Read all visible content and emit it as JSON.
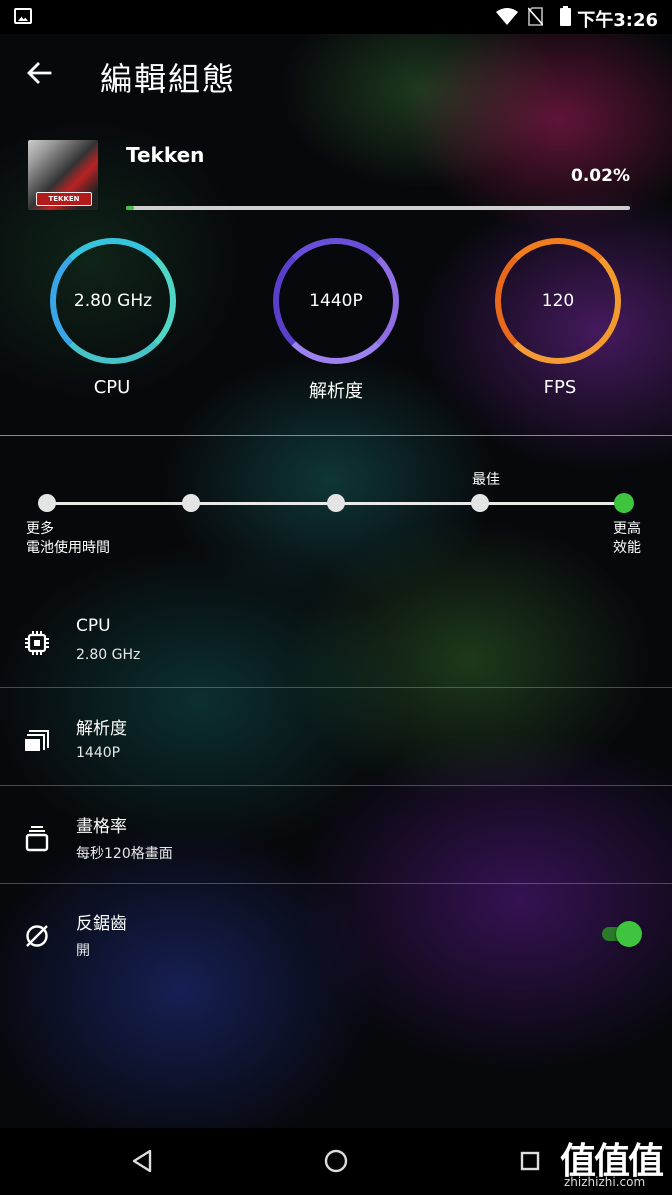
{
  "status_bar": {
    "time": "下午3:26",
    "icons": [
      "image-icon",
      "wifi-icon",
      "no-sim-icon",
      "battery-icon"
    ]
  },
  "header": {
    "title": "編輯組態",
    "back_icon": "arrow-back-icon"
  },
  "game": {
    "name": "Tekken",
    "thumbnail_text": "TEKKEN",
    "usage_percent_label": "0.02%",
    "usage_percent": 0.02
  },
  "summary": {
    "cpu": {
      "value": "2.80 GHz",
      "label": "CPU",
      "color": "#35c4dc"
    },
    "resolution": {
      "value": "1440P",
      "label": "解析度",
      "color": "#7b5fe0"
    },
    "fps": {
      "value": "120",
      "label": "FPS",
      "color": "#f08a22"
    }
  },
  "slider": {
    "steps": 5,
    "selected_step": 5,
    "best_label": "最佳",
    "left_label_1": "更多",
    "left_label_2": "電池使用時間",
    "right_label_1": "更高",
    "right_label_2": "效能",
    "active_color": "#3ec43e"
  },
  "settings": [
    {
      "icon": "cpu-chip-icon",
      "title": "CPU",
      "value": "2.80 GHz"
    },
    {
      "icon": "resolution-icon",
      "title": "解析度",
      "value": "1440P"
    },
    {
      "icon": "frame-rate-icon",
      "title": "畫格率",
      "value": "每秒120格畫面"
    },
    {
      "icon": "anti-aliasing-icon",
      "title": "反鋸齒",
      "value": "開",
      "toggle_on": true
    }
  ],
  "nav_bar": {
    "icons": [
      "nav-back-icon",
      "nav-home-icon",
      "nav-recents-icon"
    ]
  },
  "watermark": {
    "brand": "值值值",
    "site": "zhizhizhi.com"
  }
}
